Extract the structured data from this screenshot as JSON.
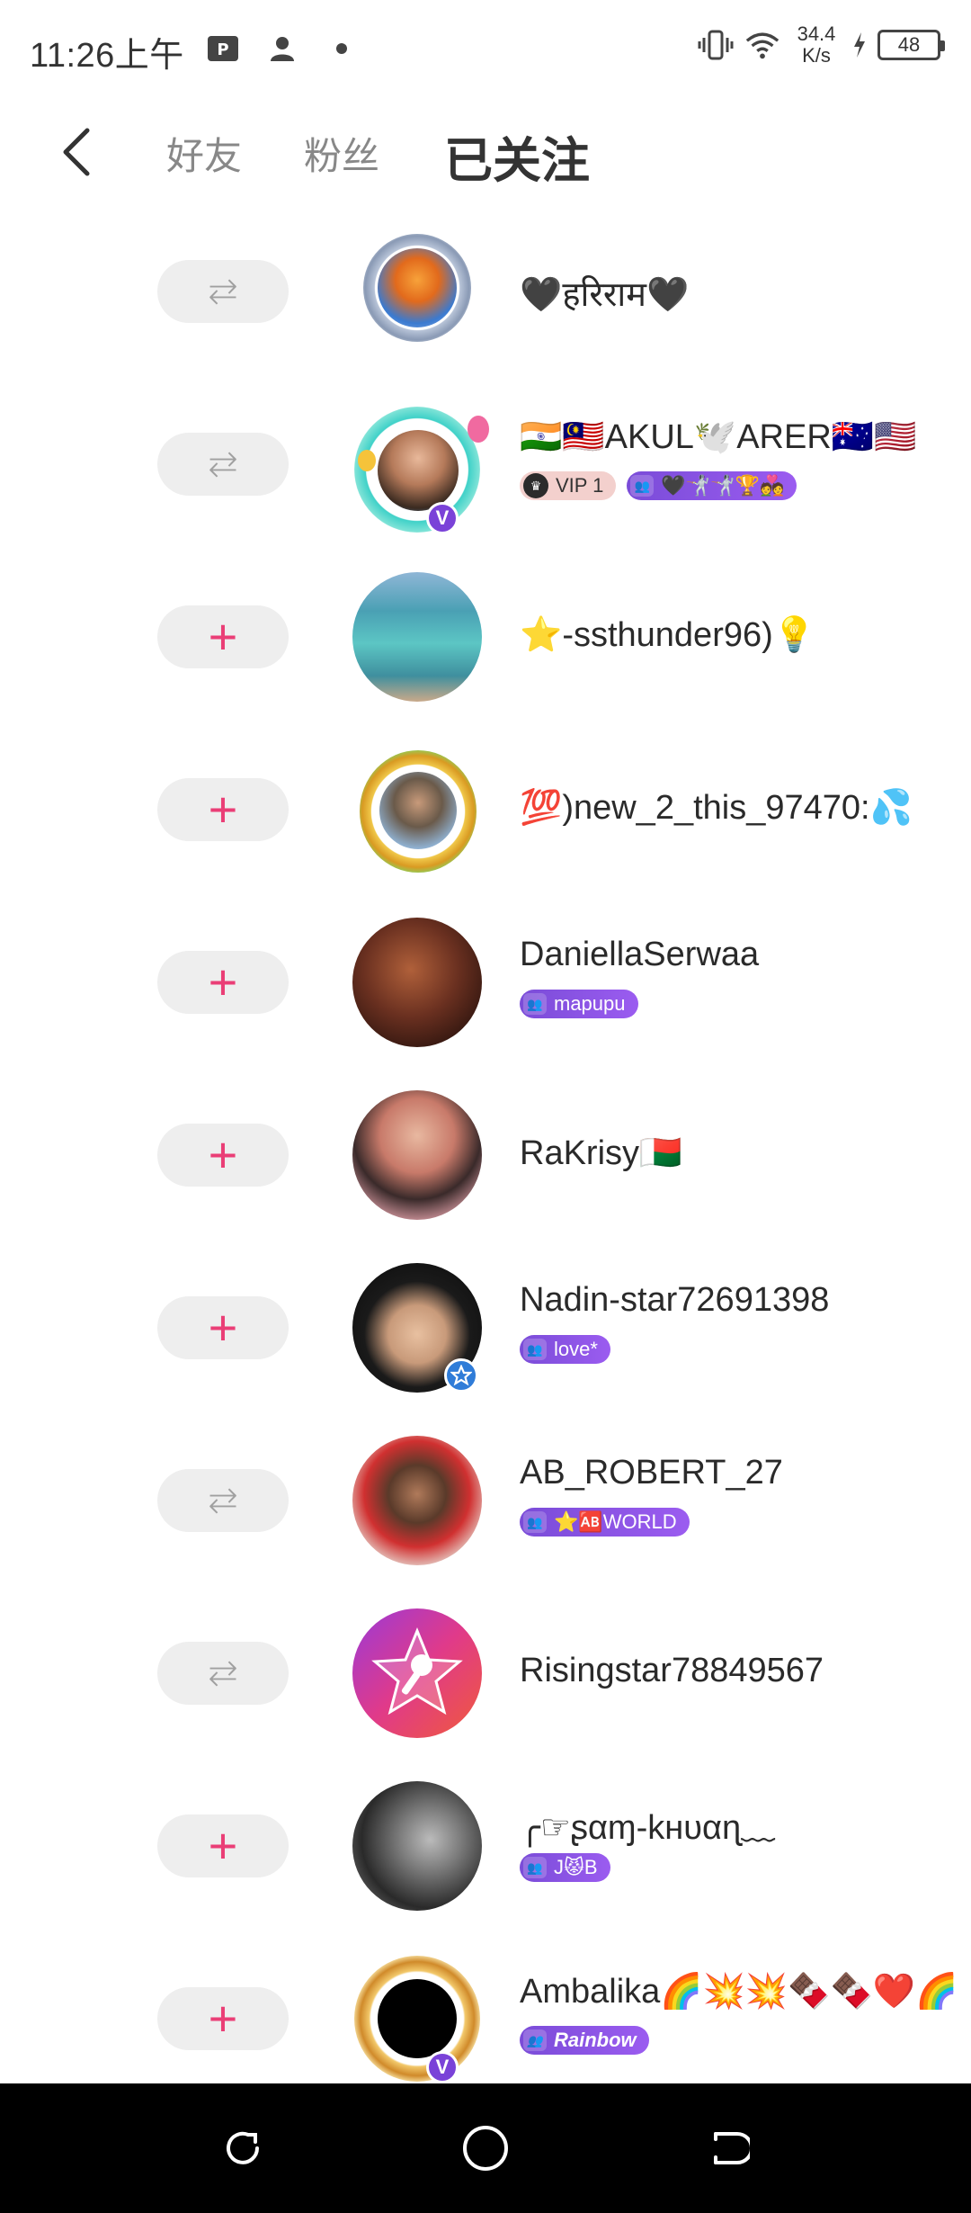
{
  "status_bar": {
    "time": "11:26上午",
    "net_speed_value": "34.4",
    "net_speed_unit": "K/s",
    "battery": "48"
  },
  "header": {
    "tabs": [
      {
        "label": "好友",
        "active": false
      },
      {
        "label": "粉丝",
        "active": false
      },
      {
        "label": "已关注",
        "active": true
      }
    ]
  },
  "rows": [
    {
      "name": "🖤हरिराम🖤",
      "button": "mutual",
      "badges": []
    },
    {
      "name": "🇮🇳🇲🇾AKUL🕊️ARER🇦🇺🇺🇸",
      "button": "mutual",
      "badges": [
        {
          "type": "vip",
          "text": "VIP 1"
        },
        {
          "type": "group",
          "text": "🖤🤺🤺🏆💑"
        }
      ]
    },
    {
      "name": "⭐-ssthunder96)💡",
      "button": "plus",
      "badges": []
    },
    {
      "name": "💯)new_2_this_97470:💦",
      "button": "plus",
      "badges": []
    },
    {
      "name": "DaniellaSerwaa",
      "button": "plus",
      "badges": [
        {
          "type": "group",
          "text": "mapupu"
        }
      ]
    },
    {
      "name": "RaKrisy🇲🇬",
      "button": "plus",
      "badges": []
    },
    {
      "name": "Nadin-star72691398",
      "button": "plus",
      "badges": [
        {
          "type": "group",
          "text": "love*"
        }
      ]
    },
    {
      "name": "AB_ROBERT_27",
      "button": "mutual",
      "badges": [
        {
          "type": "group",
          "text": "⭐🆎WORLD"
        }
      ]
    },
    {
      "name": "Risingstar78849567",
      "button": "mutual",
      "badges": []
    },
    {
      "name": "╭☞ʂαɱ-kнυαɳ﹏",
      "button": "plus",
      "badges": [
        {
          "type": "group",
          "text": "J😾B"
        }
      ]
    },
    {
      "name": "Ambalika🌈💥💥🍫🍫❤️🌈",
      "button": "plus",
      "badges": [
        {
          "type": "group",
          "text": "Rainbow"
        }
      ]
    }
  ],
  "buttons": {
    "plus_label": "+",
    "mutual_label": "⇆"
  },
  "colors": {
    "accent": "#ea3e76",
    "badge_purple": "#8a52e6",
    "vip_bg": "#f3d0cd"
  },
  "nav": {
    "left": "recent-apps-icon",
    "center": "home-icon",
    "right": "back-icon"
  }
}
